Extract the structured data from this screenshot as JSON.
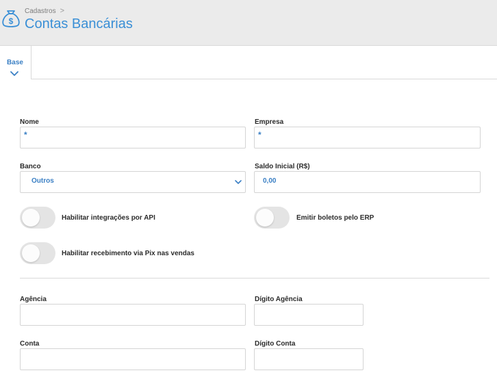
{
  "header": {
    "breadcrumb": "Cadastros",
    "breadcrumb_separator": ">",
    "title": "Contas Bancárias",
    "logo_icon": "money-bag-icon",
    "accent_color": "#3a8fd6"
  },
  "tabs": [
    {
      "label": "Base",
      "icon": "chevron-down-icon"
    }
  ],
  "form": {
    "nome": {
      "label": "Nome",
      "value": "*"
    },
    "empresa": {
      "label": "Empresa",
      "value": "*"
    },
    "banco": {
      "label": "Banco",
      "value": "Outros"
    },
    "saldo": {
      "label": "Saldo Inicial (R$)",
      "value": "0,00"
    },
    "toggles": {
      "api": {
        "label": "Habilitar integrações por API",
        "on": false
      },
      "boletos": {
        "label": "Emitir boletos pelo ERP",
        "on": false
      },
      "pix": {
        "label": "Habilitar recebimento via Pix nas vendas",
        "on": false
      }
    },
    "agencia": {
      "label": "Agência",
      "value": ""
    },
    "digito_agencia": {
      "label": "Dígito Agência",
      "value": ""
    },
    "conta": {
      "label": "Conta",
      "value": ""
    },
    "digito_conta": {
      "label": "Dígito Conta",
      "value": ""
    }
  }
}
